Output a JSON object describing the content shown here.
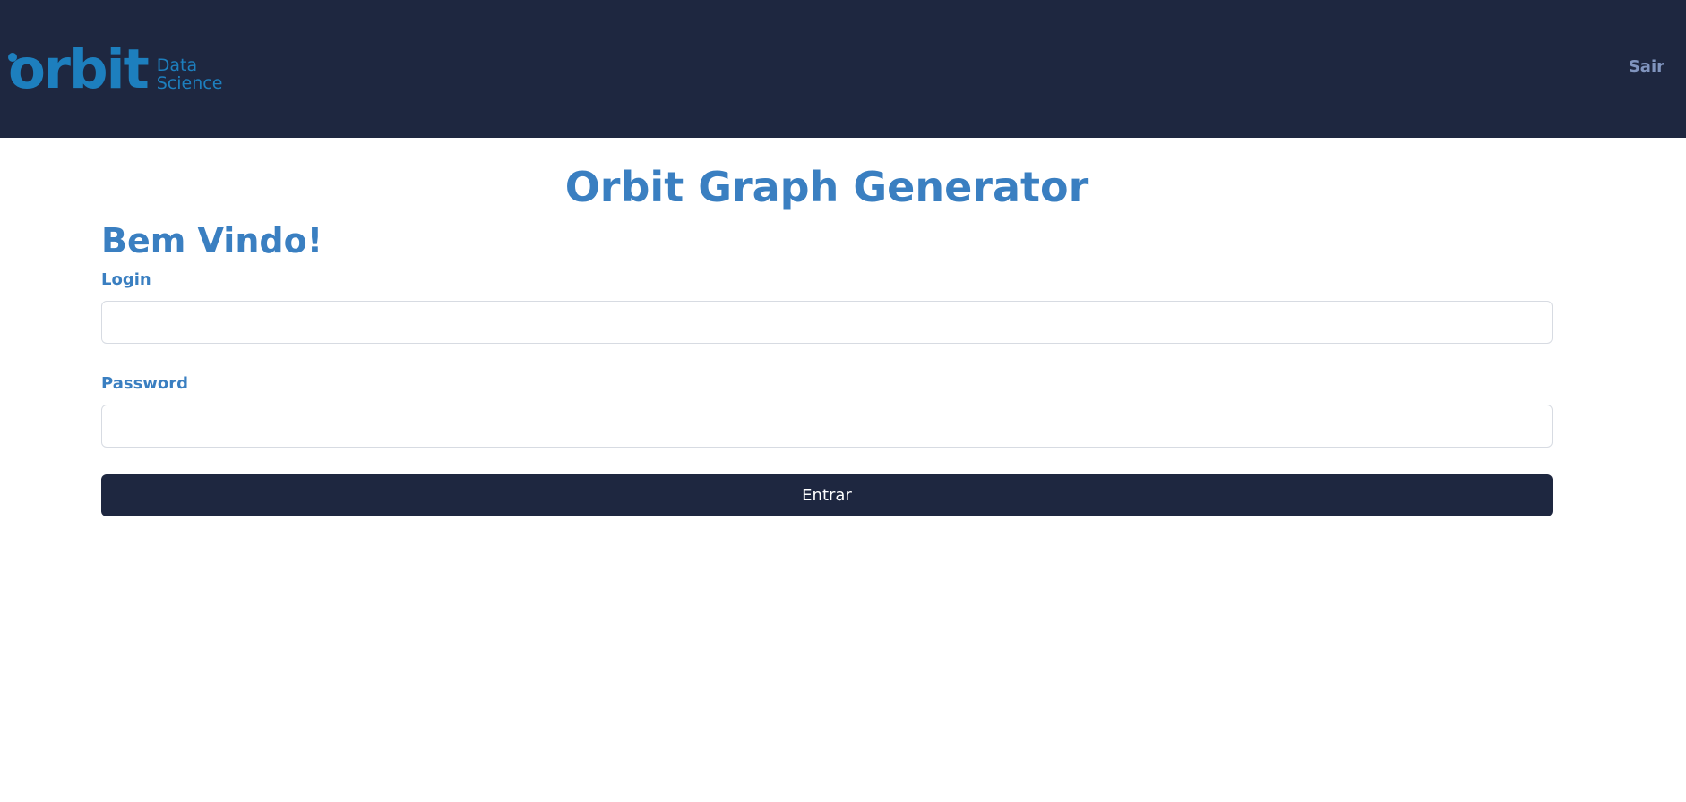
{
  "header": {
    "logo_text": "orbit",
    "logo_sub_line1": "Data",
    "logo_sub_line2": "Science",
    "logout_label": "Sair"
  },
  "main": {
    "title": "Orbit Graph Generator",
    "welcome": "Bem Vindo!",
    "login_label": "Login",
    "login_value": "",
    "password_label": "Password",
    "password_value": "",
    "submit_label": "Entrar"
  },
  "colors": {
    "header_bg": "#1e2740",
    "logo": "#1d7fbe",
    "accent_text": "#3a7fc1",
    "logout_text": "#8094be",
    "button_bg": "#1e2740",
    "button_text": "#ffffff"
  }
}
